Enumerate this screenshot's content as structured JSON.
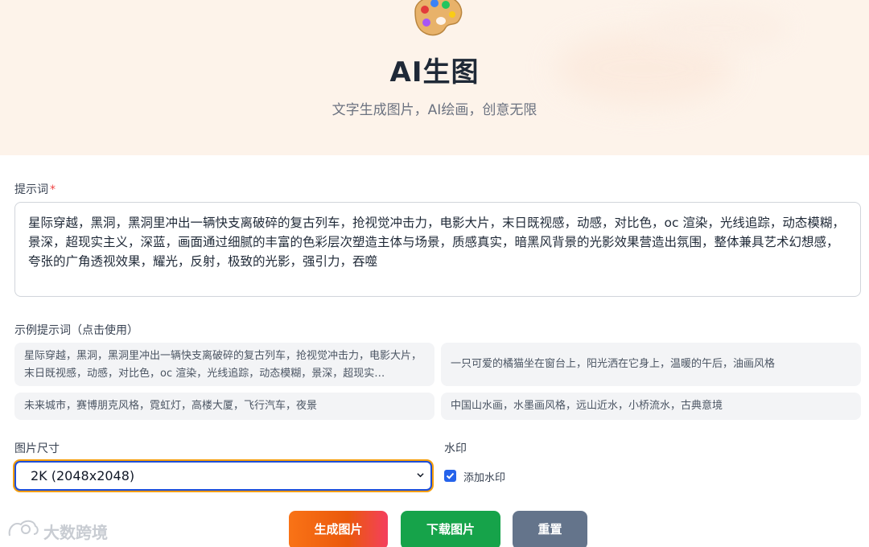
{
  "header": {
    "icon": "palette-icon",
    "title": "AI生图",
    "subtitle": "文字生成图片，AI绘画，创意无限"
  },
  "prompt": {
    "label": "提示词",
    "required_mark": "*",
    "value": "星际穿越，黑洞，黑洞里冲出一辆快支离破碎的复古列车，抢视觉冲击力，电影大片，末日既视感，动感，对比色，oc 渲染，光线追踪，动态模糊，景深，超现实主义，深蓝，画面通过细腻的丰富的色彩层次塑造主体与场景，质感真实，暗黑风背景的光影效果营造出氛围，整体兼具艺术幻想感，夸张的广角透视效果，耀光，反射，极致的光影，强引力，吞噬"
  },
  "examples": {
    "label": "示例提示词（点击使用）",
    "items": [
      "星际穿越，黑洞，黑洞里冲出一辆快支离破碎的复古列车，抢视觉冲击力，电影大片，末日既视感，动感，对比色，oc 渲染，光线追踪，动态模糊，景深，超现实…",
      "一只可爱的橘猫坐在窗台上，阳光洒在它身上，温暖的午后，油画风格",
      "未来城市，赛博朋克风格，霓虹灯，高楼大厦，飞行汽车，夜景",
      "中国山水画，水墨画风格，远山近水，小桥流水，古典意境"
    ]
  },
  "size": {
    "label": "图片尺寸",
    "selected": "2K (2048x2048)"
  },
  "watermark": {
    "label": "水印",
    "checkbox_label": "添加水印",
    "checked": true
  },
  "buttons": {
    "generate": "生成图片",
    "download": "下载图片",
    "reset": "重置"
  },
  "brand_watermark": "大数跨境",
  "colors": {
    "hero_bg": "#fdf3ea",
    "generate": "#f97316",
    "download": "#16a34a",
    "reset": "#64748b",
    "focus": "#1d4ed8"
  }
}
